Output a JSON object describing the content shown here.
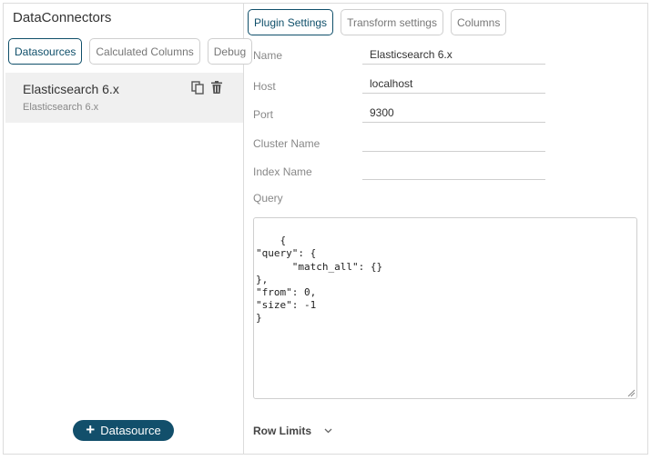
{
  "left_panel": {
    "title": "DataConnectors",
    "tabs": [
      {
        "label": "Datasources",
        "active": true
      },
      {
        "label": "Calculated Columns",
        "active": false
      },
      {
        "label": "Debug",
        "active": false
      }
    ],
    "datasource": {
      "name": "Elasticsearch 6.x",
      "type": "Elasticsearch 6.x",
      "icons": [
        "copy-icon",
        "trash-icon"
      ]
    },
    "add_button_label": "Datasource"
  },
  "right_panel": {
    "tabs": [
      {
        "label": "Plugin Settings",
        "active": true
      },
      {
        "label": "Transform settings",
        "active": false
      },
      {
        "label": "Columns",
        "active": false
      }
    ],
    "fields": {
      "name_label": "Name",
      "name_value": "Elasticsearch 6.x",
      "host_label": "Host",
      "host_value": "localhost",
      "port_label": "Port",
      "port_value": "9300",
      "cluster_label": "Cluster Name",
      "cluster_value": "",
      "index_label": "Index Name",
      "index_value": "",
      "query_label": "Query",
      "query_value": "{\n\"query\": {\n      \"match_all\": {}\n},\n\"from\": 0,\n\"size\": -1\n}"
    },
    "row_limits_label": "Row Limits"
  },
  "colors": {
    "accent": "#124f6b",
    "border": "#cfcfcf",
    "selected_bg": "#f0f0f0"
  }
}
